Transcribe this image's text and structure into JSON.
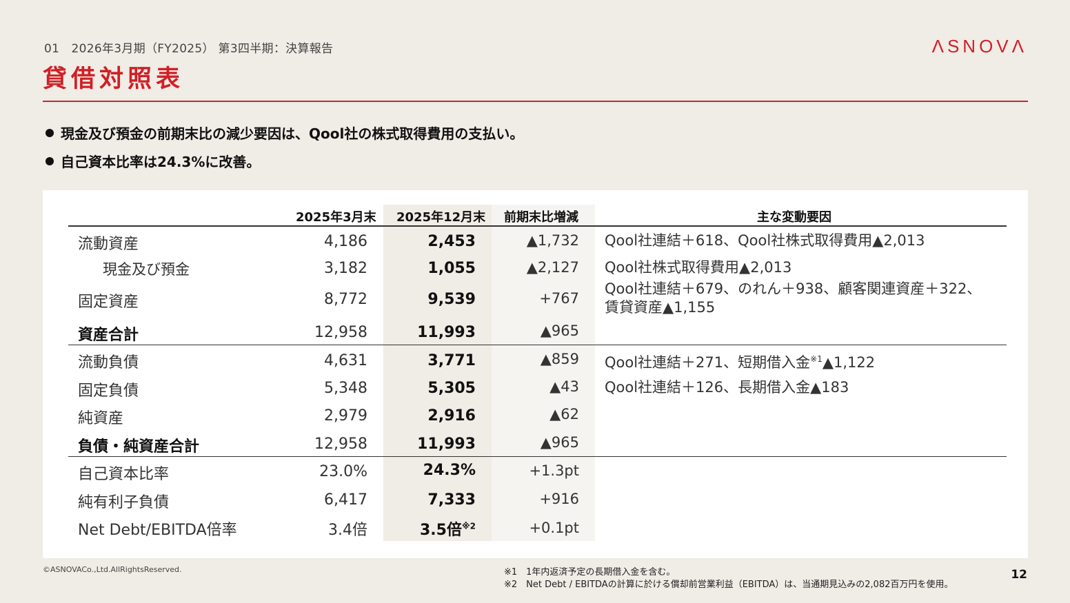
{
  "header": {
    "subtitle": "01　2026年3月期（FY2025） 第3四半期：決算報告",
    "title": "貸借対照表",
    "logo": "ΛSNOVΛ"
  },
  "bullets": [
    "現金及び預金の前期末比の減少要因は、Qool社の株式取得費用の支払い。",
    "自己資本比率は24.3%に改善。"
  ],
  "table": {
    "headers": {
      "col1": "2025年3月末",
      "col2": "2025年12月末",
      "col3": "前期末比増減",
      "col4": "主な変動要因"
    },
    "rows": [
      {
        "label": "流動資産",
        "v1": "4,186",
        "v2": "2,453",
        "diff": "▲1,732",
        "note": "Qool社連結＋618、Qool社株式取得費用▲2,013"
      },
      {
        "label": "現金及び預金",
        "v1": "3,182",
        "v2": "1,055",
        "diff": "▲2,127",
        "note": "Qool社株式取得費用▲2,013"
      },
      {
        "label": "固定資産",
        "v1": "8,772",
        "v2": "9,539",
        "diff": "+767",
        "note": "Qool社連結＋679、のれん＋938、顧客関連資産＋322、",
        "note2": "賃貸資産▲1,155"
      },
      {
        "label": "資産合計",
        "v1": "12,958",
        "v2": "11,993",
        "diff": "▲965",
        "note": ""
      },
      {
        "label": "流動負債",
        "v1": "4,631",
        "v2": "3,771",
        "diff": "▲859",
        "note": "Qool社連結＋271、短期借入金",
        "note_sup": "※1",
        "note_tail": "▲1,122"
      },
      {
        "label": "固定負債",
        "v1": "5,348",
        "v2": "5,305",
        "diff": "▲43",
        "note": "Qool社連結＋126、長期借入金▲183"
      },
      {
        "label": "純資産",
        "v1": "2,979",
        "v2": "2,916",
        "diff": "▲62",
        "note": ""
      },
      {
        "label": "負債・純資産合計",
        "v1": "12,958",
        "v2": "11,993",
        "diff": "▲965",
        "note": ""
      },
      {
        "label": "自己資本比率",
        "v1": "23.0%",
        "v2": "24.3%",
        "diff": "+1.3pt",
        "note": ""
      },
      {
        "label": "純有利子負債",
        "v1": "6,417",
        "v2": "7,333",
        "diff": "+916",
        "note": ""
      },
      {
        "label": "Net Debt/EBITDA倍率",
        "v1": "3.4倍",
        "v2": "3.5倍",
        "v2_sup": "※2",
        "diff": "+0.1pt",
        "note": ""
      }
    ]
  },
  "footer": {
    "copyright": "©ASNOVACo.,Ltd.AllRightsReserved.",
    "note1": "※1　1年内返済予定の長期借入金を含む。",
    "note2": "※2　Net Debt / EBITDAの計算に於ける償却前営業利益（EBITDA）は、当通期見込みの2,082百万円を使用。",
    "page": "12"
  }
}
